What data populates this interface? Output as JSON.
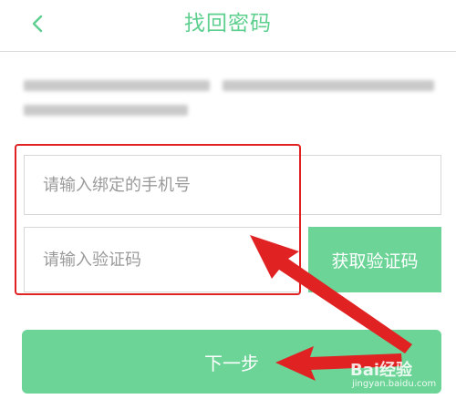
{
  "header": {
    "title": "找回密码",
    "back_icon": "chevron-left-icon"
  },
  "form": {
    "phone_placeholder": "请输入绑定的手机号",
    "phone_value": "",
    "code_placeholder": "请输入验证码",
    "code_value": "",
    "get_code_label": "获取验证码",
    "next_label": "下一步"
  },
  "watermark": {
    "brand": "Bai经验",
    "sub": "jingyan.baidu.com"
  },
  "colors": {
    "accent": "#6bd496",
    "title": "#5dcf8e",
    "annotation": "#e02222"
  }
}
